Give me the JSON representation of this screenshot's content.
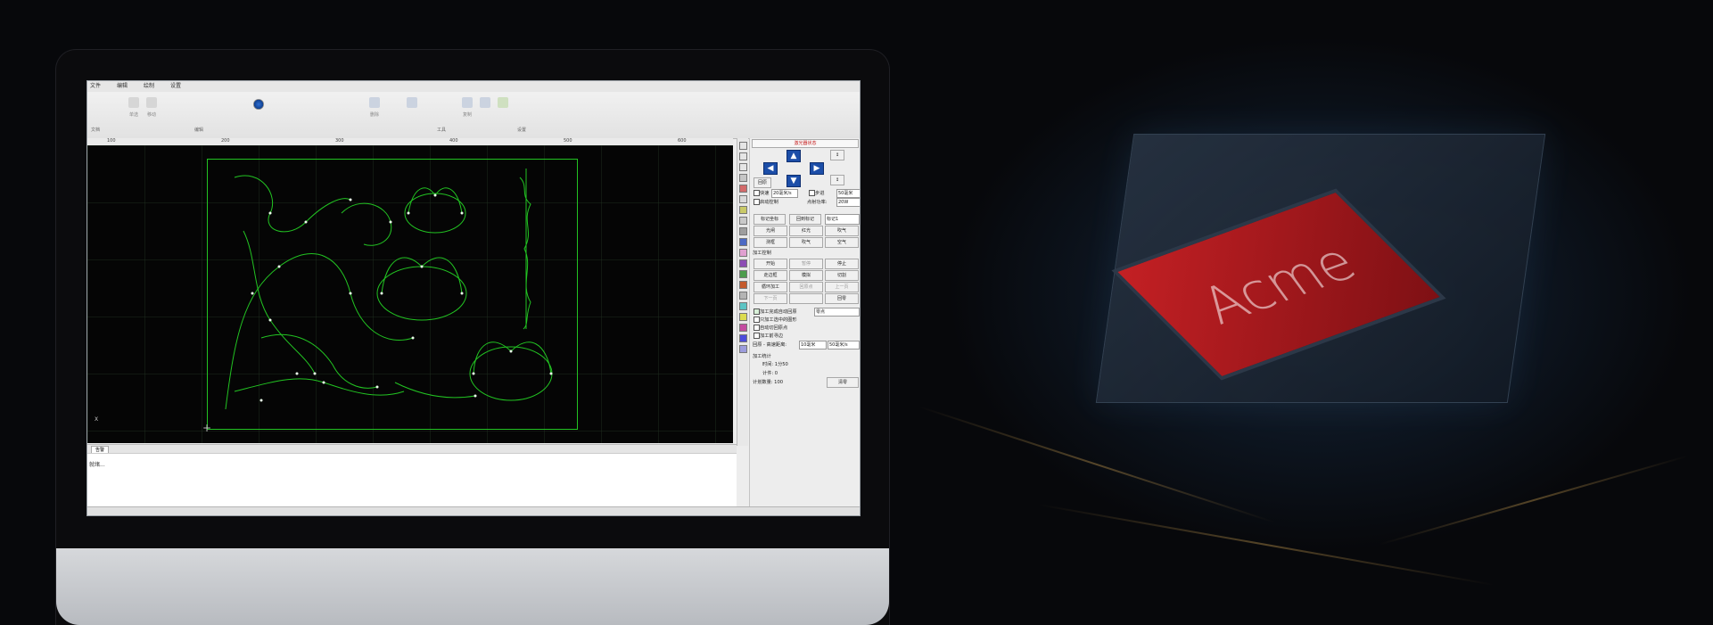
{
  "app": {
    "menu": [
      "文件",
      "编辑",
      "绘制",
      "设置"
    ],
    "ribbon_labels": [
      "文档",
      "编辑",
      "工具",
      "设置"
    ],
    "ribbon_tools": [
      "单选",
      "移动",
      "删除",
      "复制"
    ]
  },
  "canvas": {
    "ruler_ticks": [
      "100",
      "200",
      "300",
      "400",
      "500",
      "600"
    ],
    "axis_label": "X",
    "line_color": "#22c322"
  },
  "panel": {
    "header": "激光器状态",
    "arrows": {
      "up": "▲",
      "down": "▼",
      "left": "◀",
      "right": "▶"
    },
    "home_btn": "回原",
    "speed_label": "快速",
    "speed_value": "20毫米/s",
    "step_label": "步进",
    "step_value": "50毫米",
    "focus_label": "启动控制",
    "power_label": "点射功率:",
    "power_value": "20W",
    "mark_btn": "标记坐标",
    "pos_btn": "回到标记",
    "mark_sel": "标记1",
    "btns_row1": [
      "光闸",
      "红光",
      "吹气"
    ],
    "btns_row2": [
      "测框",
      "吹气",
      "空气"
    ],
    "process_title": "加工控制",
    "start_btn": "开始",
    "pause_btn": "暂停",
    "stop_btn": "停止",
    "walk_btn": "走边框",
    "sim_btn": "模拟",
    "cut_btn": "切割",
    "loop_btn": "循环加工",
    "origin_btn": "回原点",
    "prev_btn": "上一页",
    "next_btn": "下一页",
    "home2_btn": "回零",
    "options": [
      "加工完成自动回原",
      "只加工选中的图形",
      "自动切回原点",
      "加工前寻边"
    ],
    "return_sel": "零点",
    "speed_row_label": "回原 - 高速距离:",
    "speed_row_v1": "10毫米",
    "speed_row_v2": "50毫米/s",
    "stats_title": "加工统计",
    "time_label": "时间: 1分50",
    "count_label": "计件: 0",
    "total_label": "计划数量: 100",
    "clear_btn": "清零"
  },
  "output": {
    "tab_label": "告警",
    "message": "就绪..."
  },
  "colors": {
    "swatches": [
      "#e5e5e5",
      "#e5e5e5",
      "#e5e5e5",
      "#c6c6c6",
      "#d36a6a",
      "#dadada",
      "#c9c968",
      "#c9c9c9",
      "#9e9e9e",
      "#4c6ac4",
      "#e0a0d0",
      "#8c4cb4",
      "#4c9c4c",
      "#c45a2c",
      "#b4b4b4",
      "#5cc4c4",
      "#dcdc50",
      "#c44ca0",
      "#4c4cdc",
      "#9c9cdc"
    ]
  }
}
